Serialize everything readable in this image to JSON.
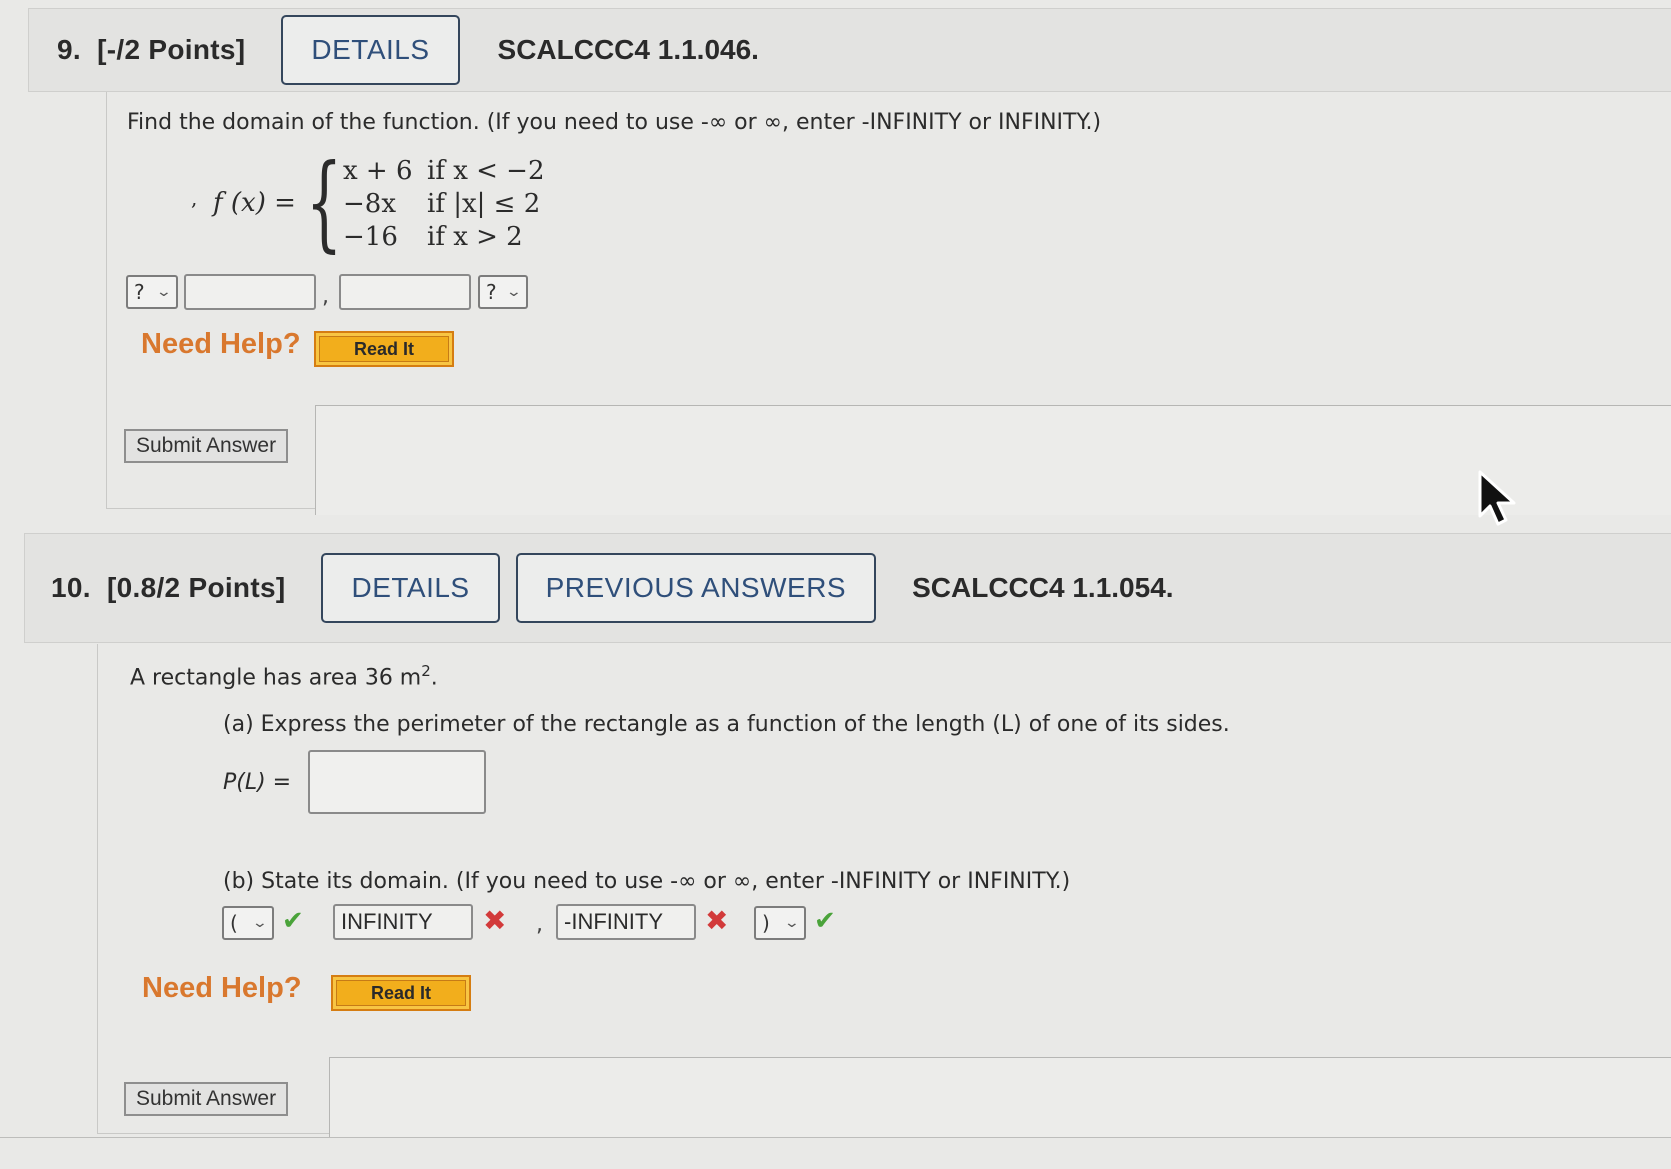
{
  "questions": [
    {
      "number": "9.",
      "points": "[-/2 Points]",
      "buttons": {
        "details": "DETAILS"
      },
      "code": "SCALCCC4 1.1.046.",
      "prompt": "Find the domain of the function. (If you need to use -∞ or ∞, enter -INFINITY or INFINITY.)",
      "function": {
        "lhs": "f (x) =",
        "pieces": [
          {
            "expr": "x + 6",
            "cond": "if x < −2"
          },
          {
            "expr": "−8x",
            "cond": "if |x| ≤ 2"
          },
          {
            "expr": "−16",
            "cond": "if x > 2"
          }
        ]
      },
      "answer": {
        "left_bracket": "?",
        "left_value": "",
        "separator": ",",
        "right_value": "",
        "right_bracket": "?"
      },
      "help": {
        "label": "Need Help?",
        "read_it": "Read It"
      },
      "submit": "Submit Answer"
    },
    {
      "number": "10.",
      "points": "[0.8/2 Points]",
      "buttons": {
        "details": "DETAILS",
        "previous": "PREVIOUS ANSWERS"
      },
      "code": "SCALCCC4 1.1.054.",
      "prompt_prefix": "A rectangle has area 36 m",
      "prompt_sup": "2",
      "prompt_suffix": ".",
      "part_a": {
        "text": "(a) Express the perimeter of the rectangle as a function of the length (L) of one of its sides.",
        "label": "P(L) =",
        "value": ""
      },
      "part_b": {
        "text": "(b) State its domain. (If you need to use -∞ or ∞, enter -INFINITY or INFINITY.)",
        "left_bracket": "(",
        "left_bracket_status": "correct",
        "left_value": "INFINITY",
        "left_value_status": "incorrect",
        "separator": ",",
        "right_value": "-INFINITY",
        "right_value_status": "incorrect",
        "right_bracket": ")",
        "right_bracket_status": "correct"
      },
      "help": {
        "label": "Need Help?",
        "read_it": "Read It"
      },
      "submit": "Submit Answer"
    }
  ],
  "icons": {
    "check": "✔",
    "cross": "✖",
    "chevron": "⌄"
  },
  "colors": {
    "correct": "#4aa33a",
    "incorrect": "#d23a3a",
    "help": "#d9782e",
    "read_it": "#f2ae1c",
    "details_text": "#2f4f7a"
  }
}
